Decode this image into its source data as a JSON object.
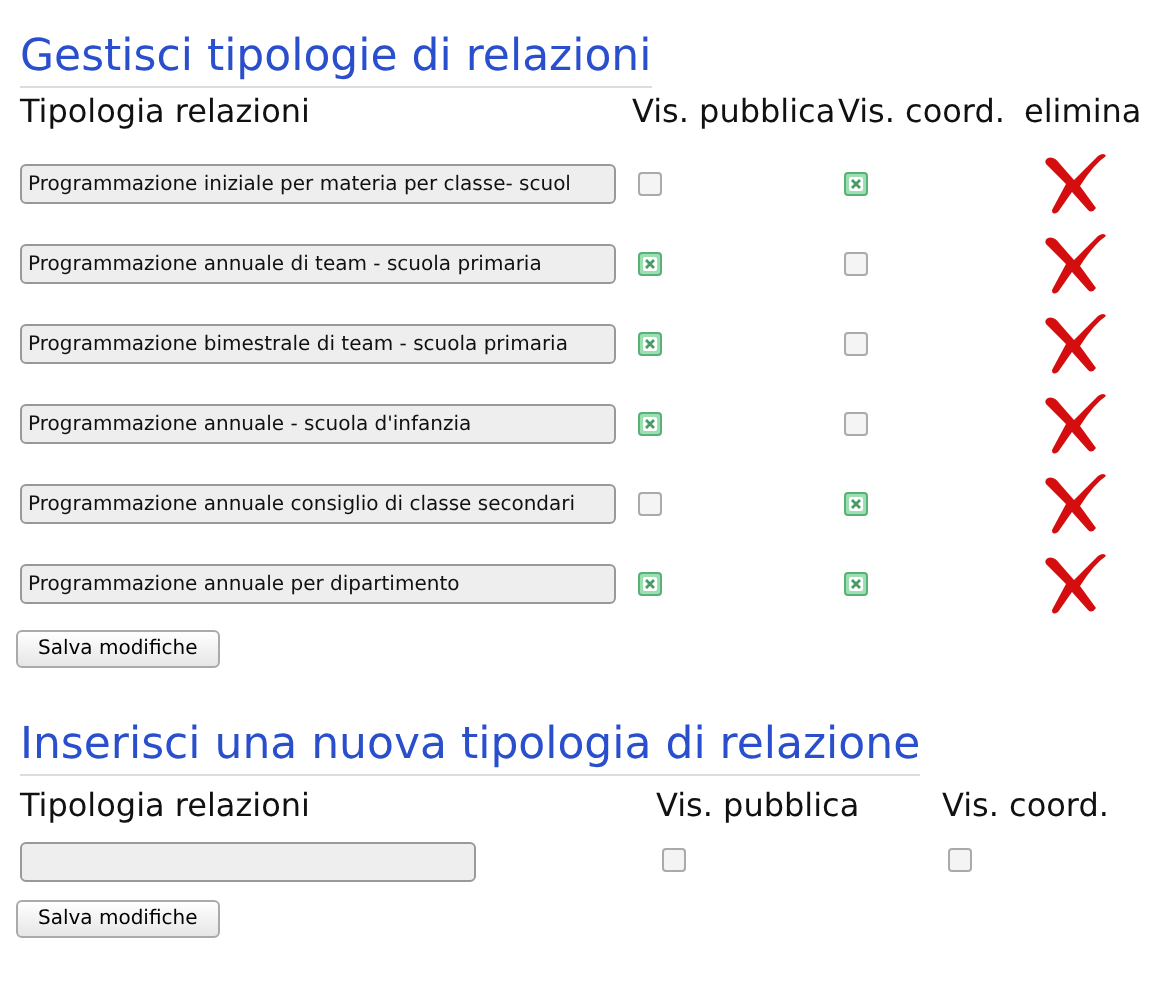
{
  "manage": {
    "title": "Gestisci tipologie di relazioni",
    "columns": [
      "Tipologia relazioni",
      "Vis. pubblica",
      "Vis. coord.",
      "elimina"
    ],
    "rows": [
      {
        "name": "Programmazione iniziale per materia per classe- scuol",
        "public": false,
        "coord": true
      },
      {
        "name": "Programmazione annuale di team - scuola primaria",
        "public": true,
        "coord": false
      },
      {
        "name": "Programmazione bimestrale di team - scuola primaria",
        "public": true,
        "coord": false
      },
      {
        "name": "Programmazione annuale - scuola d'infanzia",
        "public": true,
        "coord": false
      },
      {
        "name": "Programmazione annuale consiglio di classe secondari",
        "public": false,
        "coord": true
      },
      {
        "name": "Programmazione annuale per dipartimento",
        "public": true,
        "coord": true
      }
    ],
    "save": "Salva modifiche"
  },
  "insert": {
    "title": "Inserisci una nuova tipologia di relazione",
    "columns": [
      "Tipologia relazioni",
      "Vis. pubblica",
      "Vis. coord."
    ],
    "public": false,
    "coord": false,
    "save": "Salva modifiche"
  }
}
